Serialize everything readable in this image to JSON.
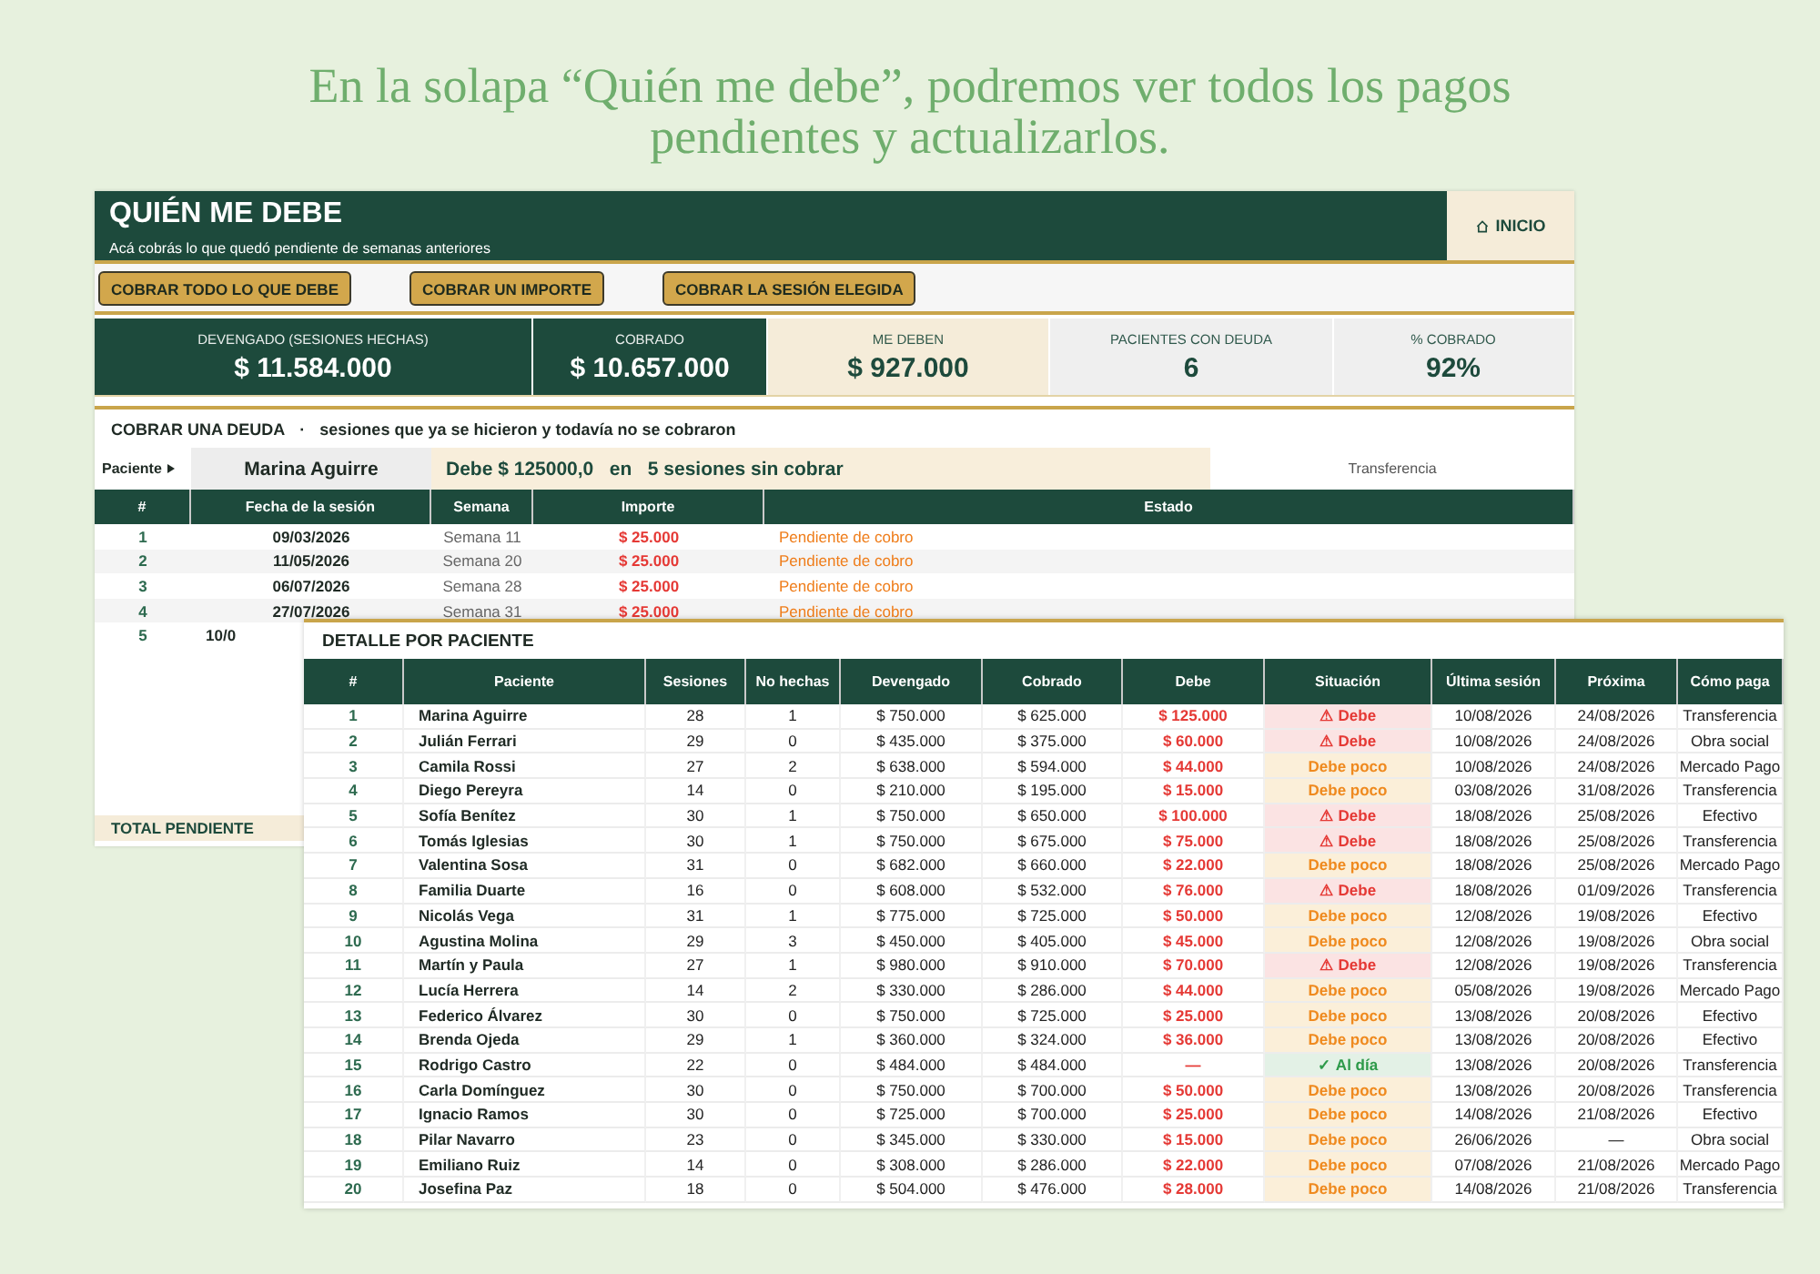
{
  "headline": [
    "En la solapa “Quién me debe”, podremos ver todos los pagos",
    "pendientes y actualizarlos."
  ],
  "sheet": {
    "title": "QUIÉN ME DEBE",
    "subtitle": "Acá cobrás lo que quedó pendiente de semanas anteriores",
    "home_button": "INICIO",
    "buttons": [
      "COBRAR TODO LO QUE DEBE",
      "COBRAR UN IMPORTE",
      "COBRAR LA SESIÓN ELEGIDA"
    ],
    "stats": [
      {
        "label": "DEVENGADO (SESIONES HECHAS)",
        "value": "$ 11.584.000",
        "kind": "dark"
      },
      {
        "label": "COBRADO",
        "value": "$ 10.657.000",
        "kind": "dark"
      },
      {
        "label": "ME DEBEN",
        "value": "$ 927.000",
        "kind": "cream"
      },
      {
        "label": "PACIENTES CON DEUDA",
        "value": "6",
        "kind": "grey"
      },
      {
        "label": "% COBRADO",
        "value": "92%",
        "kind": "grey"
      }
    ],
    "section_title": "COBRAR UNA DEUDA",
    "section_separator": "·",
    "section_subtitle": "sesiones que ya se hicieron y todavía no se cobraron",
    "patient_label": "Paciente",
    "patient_value": "Marina Aguirre",
    "debt_summary": "Debe $ 125000,0   en   5 sesiones sin cobrar",
    "payment_method": "Transferencia",
    "columns": [
      "#",
      "Fecha de la sesión",
      "Semana",
      "Importe",
      "Estado"
    ],
    "rows": [
      [
        "1",
        "09/03/2026",
        "Semana 11",
        "$ 25.000",
        "Pendiente de cobro"
      ],
      [
        "2",
        "11/05/2026",
        "Semana 20",
        "$ 25.000",
        "Pendiente de cobro"
      ],
      [
        "3",
        "06/07/2026",
        "Semana 28",
        "$ 25.000",
        "Pendiente de cobro"
      ],
      [
        "4",
        "27/07/2026",
        "Semana 31",
        "$ 25.000",
        "Pendiente de cobro"
      ],
      [
        "5",
        "10/0"
      ]
    ],
    "total_label": "TOTAL PENDIENTE"
  },
  "detail": {
    "title": "DETALLE POR PACIENTE",
    "columns": [
      "#",
      "Paciente",
      "Sesiones",
      "No hechas",
      "Devengado",
      "Cobrado",
      "Debe",
      "Situación",
      "Última sesión",
      "Próxima",
      "Cómo paga"
    ],
    "rows": [
      {
        "cells": [
          "1",
          "Marina Aguirre",
          "28",
          "1",
          "$ 750.000",
          "$ 625.000",
          "$ 125.000"
        ],
        "status": "⚠ Debe",
        "kind": "debe",
        "last": "10/08/2026",
        "next": "24/08/2026",
        "pay": "Transferencia"
      },
      {
        "cells": [
          "2",
          "Julián Ferrari",
          "29",
          "0",
          "$ 435.000",
          "$ 375.000",
          "$ 60.000"
        ],
        "status": "⚠ Debe",
        "kind": "debe",
        "last": "10/08/2026",
        "next": "24/08/2026",
        "pay": "Obra social"
      },
      {
        "cells": [
          "3",
          "Camila Rossi",
          "27",
          "2",
          "$ 638.000",
          "$ 594.000",
          "$ 44.000"
        ],
        "status": "Debe poco",
        "kind": "poco",
        "last": "10/08/2026",
        "next": "24/08/2026",
        "pay": "Mercado Pago"
      },
      {
        "cells": [
          "4",
          "Diego Pereyra",
          "14",
          "0",
          "$ 210.000",
          "$ 195.000",
          "$ 15.000"
        ],
        "status": "Debe poco",
        "kind": "poco",
        "last": "03/08/2026",
        "next": "31/08/2026",
        "pay": "Transferencia"
      },
      {
        "cells": [
          "5",
          "Sofía Benítez",
          "30",
          "1",
          "$ 750.000",
          "$ 650.000",
          "$ 100.000"
        ],
        "status": "⚠ Debe",
        "kind": "debe",
        "last": "18/08/2026",
        "next": "25/08/2026",
        "pay": "Efectivo"
      },
      {
        "cells": [
          "6",
          "Tomás Iglesias",
          "30",
          "1",
          "$ 750.000",
          "$ 675.000",
          "$ 75.000"
        ],
        "status": "⚠ Debe",
        "kind": "debe",
        "last": "18/08/2026",
        "next": "25/08/2026",
        "pay": "Transferencia"
      },
      {
        "cells": [
          "7",
          "Valentina Sosa",
          "31",
          "0",
          "$ 682.000",
          "$ 660.000",
          "$ 22.000"
        ],
        "status": "Debe poco",
        "kind": "poco",
        "last": "18/08/2026",
        "next": "25/08/2026",
        "pay": "Mercado Pago"
      },
      {
        "cells": [
          "8",
          "Familia Duarte",
          "16",
          "0",
          "$ 608.000",
          "$ 532.000",
          "$ 76.000"
        ],
        "status": "⚠ Debe",
        "kind": "debe",
        "last": "18/08/2026",
        "next": "01/09/2026",
        "pay": "Transferencia"
      },
      {
        "cells": [
          "9",
          "Nicolás Vega",
          "31",
          "1",
          "$ 775.000",
          "$ 725.000",
          "$ 50.000"
        ],
        "status": "Debe poco",
        "kind": "poco",
        "last": "12/08/2026",
        "next": "19/08/2026",
        "pay": "Efectivo"
      },
      {
        "cells": [
          "10",
          "Agustina Molina",
          "29",
          "3",
          "$ 450.000",
          "$ 405.000",
          "$ 45.000"
        ],
        "status": "Debe poco",
        "kind": "poco",
        "last": "12/08/2026",
        "next": "19/08/2026",
        "pay": "Obra social"
      },
      {
        "cells": [
          "11",
          "Martín y Paula",
          "27",
          "1",
          "$ 980.000",
          "$ 910.000",
          "$ 70.000"
        ],
        "status": "⚠ Debe",
        "kind": "debe",
        "last": "12/08/2026",
        "next": "19/08/2026",
        "pay": "Transferencia"
      },
      {
        "cells": [
          "12",
          "Lucía Herrera",
          "14",
          "2",
          "$ 330.000",
          "$ 286.000",
          "$ 44.000"
        ],
        "status": "Debe poco",
        "kind": "poco",
        "last": "05/08/2026",
        "next": "19/08/2026",
        "pay": "Mercado Pago"
      },
      {
        "cells": [
          "13",
          "Federico Álvarez",
          "30",
          "0",
          "$ 750.000",
          "$ 725.000",
          "$ 25.000"
        ],
        "status": "Debe poco",
        "kind": "poco",
        "last": "13/08/2026",
        "next": "20/08/2026",
        "pay": "Efectivo"
      },
      {
        "cells": [
          "14",
          "Brenda Ojeda",
          "29",
          "1",
          "$ 360.000",
          "$ 324.000",
          "$ 36.000"
        ],
        "status": "Debe poco",
        "kind": "poco",
        "last": "13/08/2026",
        "next": "20/08/2026",
        "pay": "Efectivo"
      },
      {
        "cells": [
          "15",
          "Rodrigo Castro",
          "22",
          "0",
          "$ 484.000",
          "$ 484.000",
          "—"
        ],
        "status": "✓ Al día",
        "kind": "ok",
        "last": "13/08/2026",
        "next": "20/08/2026",
        "pay": "Transferencia"
      },
      {
        "cells": [
          "16",
          "Carla Domínguez",
          "30",
          "0",
          "$ 750.000",
          "$ 700.000",
          "$ 50.000"
        ],
        "status": "Debe poco",
        "kind": "poco",
        "last": "13/08/2026",
        "next": "20/08/2026",
        "pay": "Transferencia"
      },
      {
        "cells": [
          "17",
          "Ignacio Ramos",
          "30",
          "0",
          "$ 725.000",
          "$ 700.000",
          "$ 25.000"
        ],
        "status": "Debe poco",
        "kind": "poco",
        "last": "14/08/2026",
        "next": "21/08/2026",
        "pay": "Efectivo"
      },
      {
        "cells": [
          "18",
          "Pilar Navarro",
          "23",
          "0",
          "$ 345.000",
          "$ 330.000",
          "$ 15.000"
        ],
        "status": "Debe poco",
        "kind": "poco",
        "last": "26/06/2026",
        "next": "—",
        "pay": "Obra social"
      },
      {
        "cells": [
          "19",
          "Emiliano Ruiz",
          "14",
          "0",
          "$ 308.000",
          "$ 286.000",
          "$ 22.000"
        ],
        "status": "Debe poco",
        "kind": "poco",
        "last": "07/08/2026",
        "next": "21/08/2026",
        "pay": "Mercado Pago"
      },
      {
        "cells": [
          "20",
          "Josefina Paz",
          "18",
          "0",
          "$ 504.000",
          "$ 476.000",
          "$ 28.000"
        ],
        "status": "Debe poco",
        "kind": "poco",
        "last": "14/08/2026",
        "next": "21/08/2026",
        "pay": "Transferencia"
      }
    ]
  }
}
